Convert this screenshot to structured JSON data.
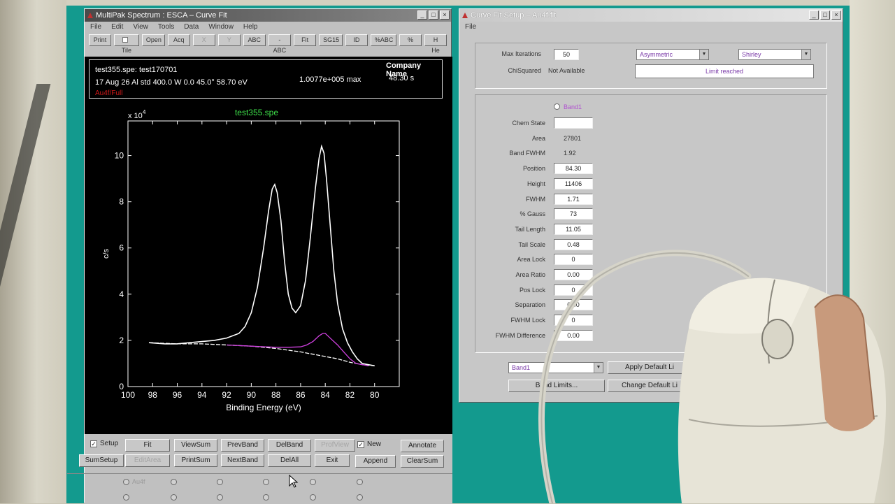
{
  "left_window": {
    "title": "MultiPak Spectrum : ESCA – Curve Fit",
    "menu": [
      "File",
      "Edit",
      "View",
      "Tools",
      "Data",
      "Window",
      "Help"
    ],
    "toolbar": [
      "Print",
      "Tile",
      "Open",
      "Acq",
      "X",
      "Y",
      "ABC",
      "-ABC",
      "Fit",
      "SG15",
      "ID",
      "%ABC",
      "%",
      "H He"
    ],
    "info": {
      "file_line": "test355.spe: test170701",
      "params_line": "17 Aug 26  Al std  400.0 W  0.0   45.0°  58.70 eV",
      "region_label": "Au4f/Full",
      "max_label": "1.0077e+005 max",
      "company": "Company Name",
      "time": "48.30 s"
    }
  },
  "chart_data": {
    "type": "line",
    "title": "test355.spe",
    "xlabel": "Binding Energy (eV)",
    "ylabel": "c/s",
    "y_multiplier_label": "x 10",
    "y_multiplier_exp": "4",
    "xlim": [
      100,
      78
    ],
    "ylim": [
      0,
      11.5
    ],
    "x_ticks": [
      100,
      98,
      96,
      94,
      92,
      90,
      88,
      86,
      84,
      82,
      80
    ],
    "y_ticks": [
      0,
      2,
      4,
      6,
      8,
      10
    ],
    "series": [
      {
        "color": "#ffffff",
        "x": [
          98.3,
          97.0,
          96.0,
          95.0,
          94.0,
          93.0,
          92.0,
          91.0,
          90.5,
          90.0,
          89.5,
          89.0,
          88.6,
          88.3,
          88.1,
          87.9,
          87.6,
          87.3,
          87.0,
          86.7,
          86.4,
          86.0,
          85.6,
          85.2,
          84.8,
          84.5,
          84.3,
          84.1,
          83.9,
          83.6,
          83.3,
          83.0,
          82.6,
          82.2,
          81.8,
          81.4,
          81.0,
          80.5,
          80.0
        ],
        "y": [
          1.9,
          1.85,
          1.85,
          1.9,
          1.95,
          2.0,
          2.1,
          2.3,
          2.6,
          3.2,
          4.3,
          6.0,
          7.6,
          8.55,
          8.75,
          8.4,
          7.2,
          5.4,
          4.0,
          3.4,
          3.2,
          3.5,
          4.6,
          6.5,
          8.6,
          9.9,
          10.4,
          10.1,
          9.0,
          7.0,
          5.0,
          3.6,
          2.5,
          1.9,
          1.5,
          1.2,
          1.0,
          0.95,
          0.9
        ]
      },
      {
        "color": "#ffffff",
        "x": [
          98.3,
          96.0,
          94.0,
          92.0,
          90.0,
          88.0,
          86.0,
          85.0,
          84.0,
          83.0,
          82.0,
          81.0,
          80.0
        ],
        "y": [
          1.9,
          1.85,
          1.85,
          1.8,
          1.75,
          1.65,
          1.5,
          1.4,
          1.3,
          1.2,
          1.05,
          0.95,
          0.9
        ]
      },
      {
        "color": "#d040e0",
        "x": [
          92.0,
          90.0,
          88.0,
          87.0,
          86.0,
          85.5,
          85.0,
          84.5,
          84.2,
          84.0,
          83.8,
          83.5,
          83.0,
          82.5,
          82.0,
          81.5,
          81.0,
          80.5
        ],
        "y": [
          1.8,
          1.75,
          1.7,
          1.7,
          1.72,
          1.8,
          1.95,
          2.2,
          2.3,
          2.3,
          2.2,
          2.05,
          1.8,
          1.5,
          1.2,
          1.0,
          0.95,
          0.9
        ]
      }
    ]
  },
  "bottom_panel": {
    "setup_label": "Setup",
    "new_label": "New",
    "buttons_row1": [
      "Fit",
      "ViewSum",
      "PrevBand",
      "DelBand",
      "ProfView",
      "Annotate"
    ],
    "buttons_row2": [
      "SumSetup",
      "EditArea",
      "PrintSum",
      "NextBand",
      "DelAll",
      "Exit",
      "Append",
      "ClearSum"
    ],
    "radio_label": "Au4f"
  },
  "right_window": {
    "title": "Curve Fit Setup – Au4f.fit",
    "menu": [
      "File"
    ],
    "max_iter_label": "Max Iterations",
    "max_iter_value": "50",
    "chisq_label": "ChiSquared",
    "chisq_value": "Not Available",
    "bg_type": "Asymmetric",
    "bg_method": "Shirley",
    "status": "Limit reached",
    "band_radio": "Band1",
    "fields": [
      {
        "label": "Chem State",
        "value": ""
      },
      {
        "label": "Area",
        "value": "27801",
        "readonly": true
      },
      {
        "label": "Band FWHM",
        "value": "1.92",
        "readonly": true
      },
      {
        "label": "Position",
        "value": "84.30"
      },
      {
        "label": "Height",
        "value": "11406"
      },
      {
        "label": "FWHM",
        "value": "1.71"
      },
      {
        "label": "% Gauss",
        "value": "73"
      },
      {
        "label": "Tail Length",
        "value": "11.05"
      },
      {
        "label": "Tail Scale",
        "value": "0.48"
      },
      {
        "label": "Area Lock",
        "value": "0"
      },
      {
        "label": "Area Ratio",
        "value": "0.00"
      },
      {
        "label": "Pos Lock",
        "value": "0"
      },
      {
        "label": "Separation",
        "value": "0.00"
      },
      {
        "label": "FWHM Lock",
        "value": "0"
      },
      {
        "label": "FWHM Difference",
        "value": "0.00"
      }
    ],
    "band_select": "Band1",
    "btn_apply": "Apply Default Li",
    "btn_band_limits": "Band Limits...",
    "btn_change": "Change Default Li"
  }
}
